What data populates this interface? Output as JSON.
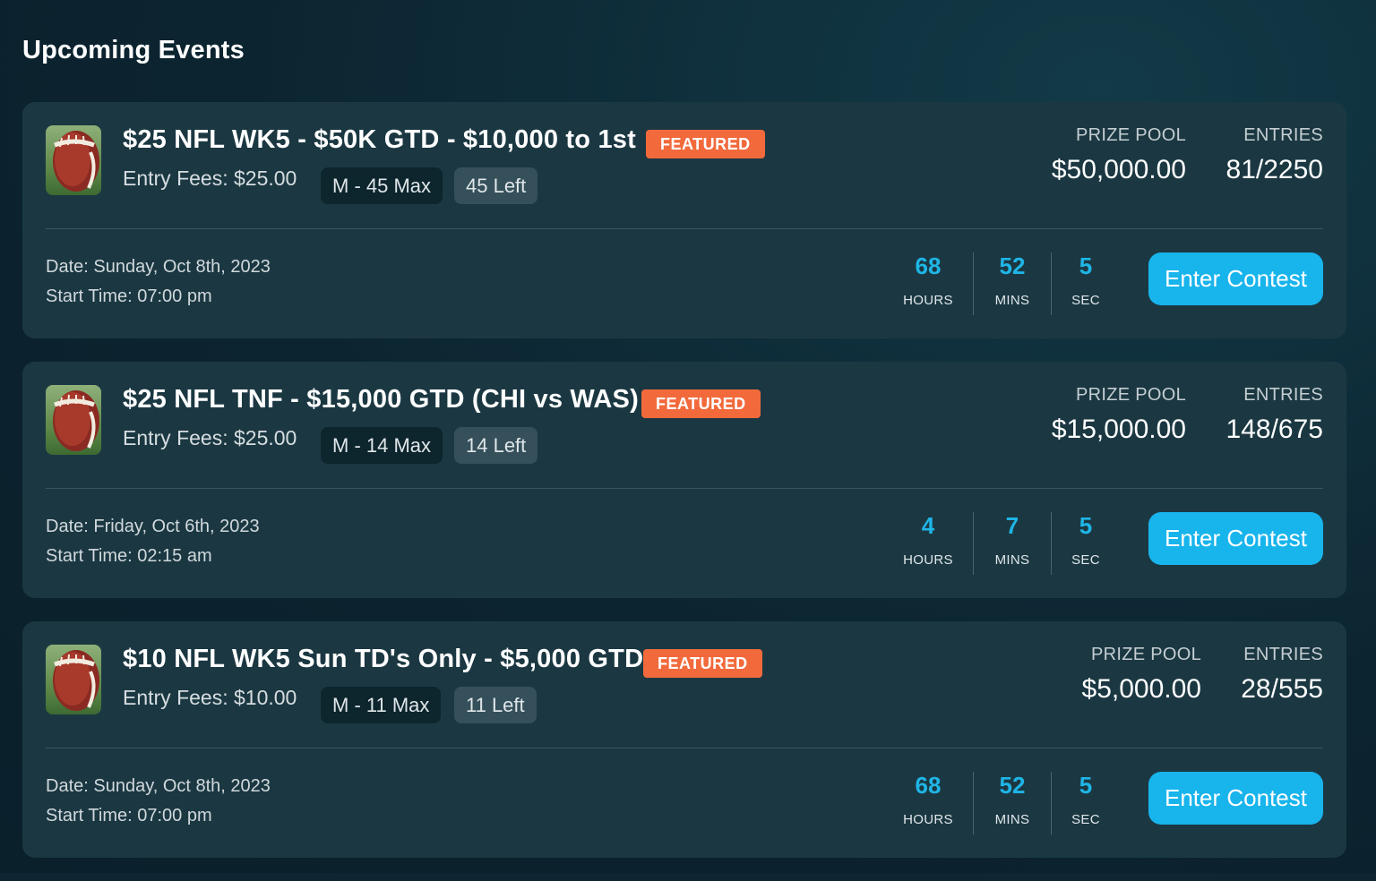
{
  "page": {
    "title": "Upcoming Events"
  },
  "labels": {
    "prize_pool": "PRIZE POOL",
    "entries": "ENTRIES",
    "hours": "HOURS",
    "mins": "MINS",
    "sec": "SEC",
    "featured": "FEATURED",
    "enter": "Enter Contest"
  },
  "colors": {
    "accent": "#18b4ec",
    "featured": "#f26a3c",
    "card_bg": "#1b3842",
    "page_bg": "#0c2430",
    "timer_number": "#1fb5e6"
  },
  "events": [
    {
      "icon": "football-icon",
      "title": "$25 NFL WK5 - $50K GTD - $10,000 to 1st",
      "featured": "FEATURED",
      "entry_fee": "Entry Fees: $25.00",
      "max_entries": "M - 45 Max",
      "left": "45 Left",
      "prize_pool": "$50,000.00",
      "entries": "81/2250",
      "date": "Date: Sunday, Oct 8th, 2023",
      "start_time": "Start Time: 07:00 pm",
      "hours": "68",
      "mins": "52",
      "sec": "5",
      "button": "Enter Contest"
    },
    {
      "icon": "football-icon",
      "title": "$25 NFL TNF - $15,000 GTD (CHI vs WAS)",
      "featured": "FEATURED",
      "entry_fee": "Entry Fees: $25.00",
      "max_entries": "M - 14 Max",
      "left": "14 Left",
      "prize_pool": "$15,000.00",
      "entries": "148/675",
      "date": "Date: Friday, Oct 6th, 2023",
      "start_time": "Start Time: 02:15 am",
      "hours": "4",
      "mins": "7",
      "sec": "5",
      "button": "Enter Contest"
    },
    {
      "icon": "football-icon",
      "title": "$10 NFL WK5 Sun TD's Only - $5,000 GTD",
      "featured": "FEATURED",
      "entry_fee": "Entry Fees: $10.00",
      "max_entries": "M - 11 Max",
      "left": "11 Left",
      "prize_pool": "$5,000.00",
      "entries": "28/555",
      "date": "Date: Sunday, Oct 8th, 2023",
      "start_time": "Start Time: 07:00 pm",
      "hours": "68",
      "mins": "52",
      "sec": "5",
      "button": "Enter Contest"
    }
  ]
}
